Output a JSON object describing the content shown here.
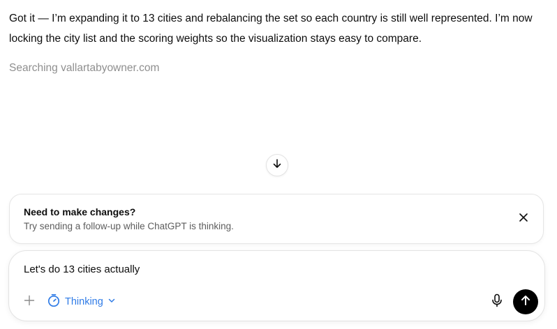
{
  "assistant": {
    "message": "Got it — I’m expanding it to 13 cities and rebalancing the set so each country is still well represented. I’m now locking the city list and the scoring weights so the visualization stays easy to compare.",
    "status": "Searching vallartabyowner.com"
  },
  "notice": {
    "title": "Need to make changes?",
    "body": "Try sending a follow-up while ChatGPT is thinking."
  },
  "composer": {
    "input_value": "Let's do 13 cities actually",
    "mode_label": "Thinking"
  },
  "icons": {
    "scroll": "arrow-down-icon",
    "close": "close-icon",
    "plus": "plus-icon",
    "mode": "timer-icon",
    "chevron": "chevron-down-icon",
    "mic": "microphone-icon",
    "send": "arrow-up-icon"
  },
  "colors": {
    "accent": "#2f7be6",
    "send_bg": "#000000",
    "muted_text": "#8f8f8f"
  }
}
